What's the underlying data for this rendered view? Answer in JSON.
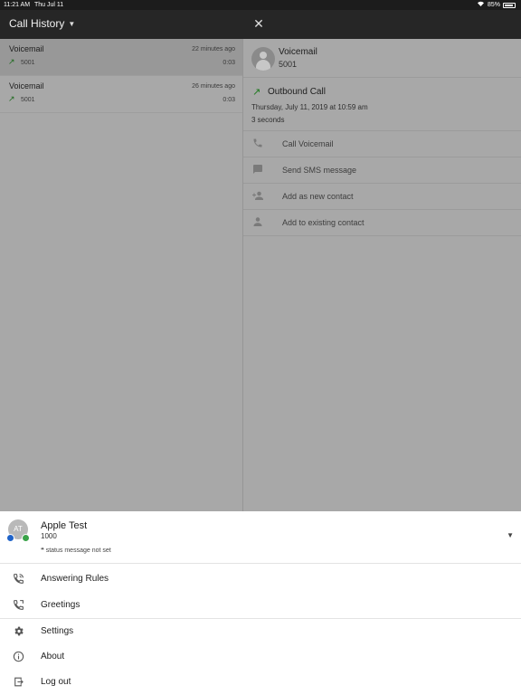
{
  "status_bar": {
    "time": "11:21 AM",
    "date": "Thu Jul 11",
    "battery": "85%"
  },
  "header": {
    "title": "Call History",
    "close_icon": "close-icon"
  },
  "calls": [
    {
      "name": "Voicemail",
      "ago": "22 minutes ago",
      "number": "5001",
      "duration": "0:03",
      "direction": "outbound"
    },
    {
      "name": "Voicemail",
      "ago": "26 minutes ago",
      "number": "5001",
      "duration": "0:03",
      "direction": "outbound"
    }
  ],
  "detail": {
    "name": "Voicemail",
    "number": "5001",
    "call_type": "Outbound Call",
    "when": "Thursday, July 11, 2019 at 10:59 am",
    "length": "3 seconds",
    "actions": [
      {
        "label": "Call Voicemail",
        "icon": "phone-icon"
      },
      {
        "label": "Send SMS message",
        "icon": "message-icon"
      },
      {
        "label": "Add as new contact",
        "icon": "add-person-icon"
      },
      {
        "label": "Add to existing contact",
        "icon": "person-icon"
      }
    ]
  },
  "user": {
    "initials": "AT",
    "name": "Apple Test",
    "extension": "1000",
    "status_message": "status message not set"
  },
  "menu": [
    {
      "label": "Answering Rules",
      "icon": "answering-rules-icon"
    },
    {
      "label": "Greetings",
      "icon": "greetings-icon"
    },
    {
      "label": "Settings",
      "icon": "gear-icon"
    },
    {
      "label": "About",
      "icon": "info-icon"
    },
    {
      "label": "Log out",
      "icon": "logout-icon"
    }
  ],
  "colors": {
    "header": "#262626",
    "outbound_arrow": "#1f7a1f",
    "presence_blue": "#1f63c9",
    "presence_green": "#3aa349"
  }
}
